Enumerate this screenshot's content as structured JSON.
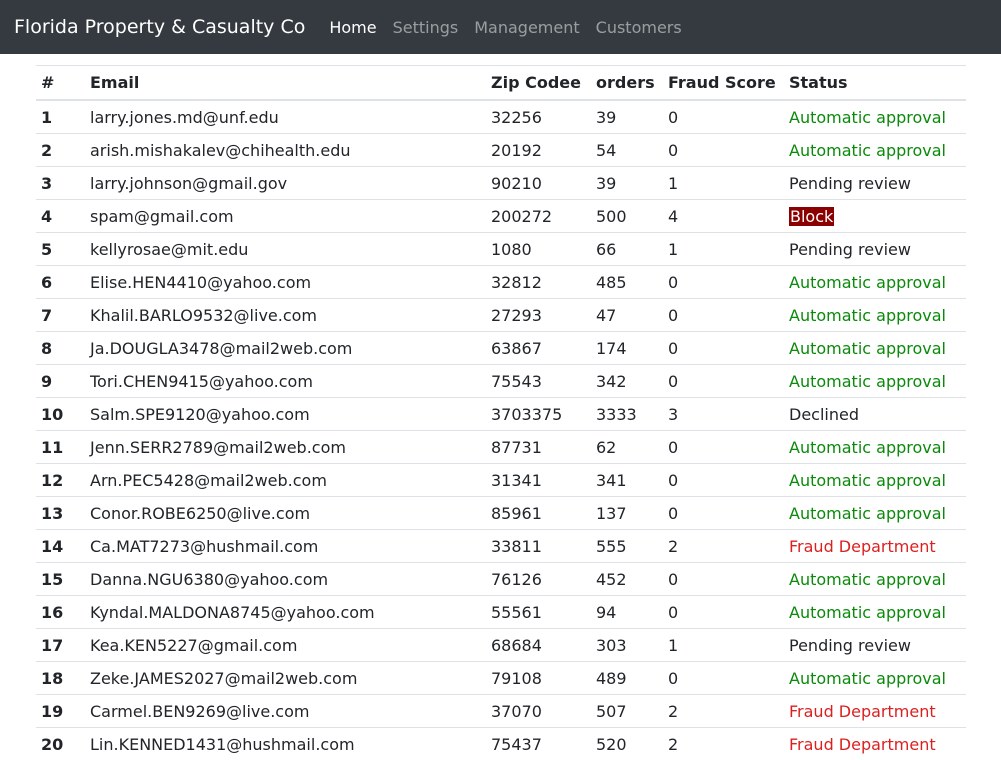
{
  "navbar": {
    "brand": "Florida Property & Casualty Co",
    "links": [
      {
        "label": "Home",
        "active": true
      },
      {
        "label": "Settings",
        "active": false
      },
      {
        "label": "Management",
        "active": false
      },
      {
        "label": "Customers",
        "active": false
      }
    ]
  },
  "table": {
    "headers": {
      "num": "#",
      "email": "Email",
      "zip": "Zip Codee",
      "orders": "orders",
      "fraud": "Fraud Score",
      "status": "Status"
    },
    "rows": [
      {
        "num": "1",
        "email": "larry.jones.md@unf.edu",
        "zip": "32256",
        "orders": "39",
        "fraud": "0",
        "status": "Automatic approval",
        "kind": "approval"
      },
      {
        "num": "2",
        "email": "arish.mishakalev@chihealth.edu",
        "zip": "20192",
        "orders": "54",
        "fraud": "0",
        "status": "Automatic approval",
        "kind": "approval"
      },
      {
        "num": "3",
        "email": "larry.johnson@gmail.gov",
        "zip": "90210",
        "orders": "39",
        "fraud": "1",
        "status": "Pending review",
        "kind": "pending"
      },
      {
        "num": "4",
        "email": "spam@gmail.com",
        "zip": "200272",
        "orders": "500",
        "fraud": "4",
        "status": "Block",
        "kind": "block"
      },
      {
        "num": "5",
        "email": "kellyrosae@mit.edu",
        "zip": "1080",
        "orders": "66",
        "fraud": "1",
        "status": "Pending review",
        "kind": "pending"
      },
      {
        "num": "6",
        "email": "Elise.HEN4410@yahoo.com",
        "zip": "32812",
        "orders": "485",
        "fraud": "0",
        "status": "Automatic approval",
        "kind": "approval"
      },
      {
        "num": "7",
        "email": "Khalil.BARLO9532@live.com",
        "zip": "27293",
        "orders": "47",
        "fraud": "0",
        "status": "Automatic approval",
        "kind": "approval"
      },
      {
        "num": "8",
        "email": "Ja.DOUGLA3478@mail2web.com",
        "zip": "63867",
        "orders": "174",
        "fraud": "0",
        "status": "Automatic approval",
        "kind": "approval"
      },
      {
        "num": "9",
        "email": "Tori.CHEN9415@yahoo.com",
        "zip": "75543",
        "orders": "342",
        "fraud": "0",
        "status": "Automatic approval",
        "kind": "approval"
      },
      {
        "num": "10",
        "email": "Salm.SPE9120@yahoo.com",
        "zip": "3703375",
        "orders": "3333",
        "fraud": "3",
        "status": "Declined",
        "kind": "declined"
      },
      {
        "num": "11",
        "email": "Jenn.SERR2789@mail2web.com",
        "zip": "87731",
        "orders": "62",
        "fraud": "0",
        "status": "Automatic approval",
        "kind": "approval"
      },
      {
        "num": "12",
        "email": "Arn.PEC5428@mail2web.com",
        "zip": "31341",
        "orders": "341",
        "fraud": "0",
        "status": "Automatic approval",
        "kind": "approval"
      },
      {
        "num": "13",
        "email": "Conor.ROBE6250@live.com",
        "zip": "85961",
        "orders": "137",
        "fraud": "0",
        "status": "Automatic approval",
        "kind": "approval"
      },
      {
        "num": "14",
        "email": "Ca.MAT7273@hushmail.com",
        "zip": "33811",
        "orders": "555",
        "fraud": "2",
        "status": "Fraud Department",
        "kind": "fraud"
      },
      {
        "num": "15",
        "email": "Danna.NGU6380@yahoo.com",
        "zip": "76126",
        "orders": "452",
        "fraud": "0",
        "status": "Automatic approval",
        "kind": "approval"
      },
      {
        "num": "16",
        "email": "Kyndal.MALDONA8745@yahoo.com",
        "zip": "55561",
        "orders": "94",
        "fraud": "0",
        "status": "Automatic approval",
        "kind": "approval"
      },
      {
        "num": "17",
        "email": "Kea.KEN5227@gmail.com",
        "zip": "68684",
        "orders": "303",
        "fraud": "1",
        "status": "Pending review",
        "kind": "pending"
      },
      {
        "num": "18",
        "email": "Zeke.JAMES2027@mail2web.com",
        "zip": "79108",
        "orders": "489",
        "fraud": "0",
        "status": "Automatic approval",
        "kind": "approval"
      },
      {
        "num": "19",
        "email": "Carmel.BEN9269@live.com",
        "zip": "37070",
        "orders": "507",
        "fraud": "2",
        "status": "Fraud Department",
        "kind": "fraud"
      },
      {
        "num": "20",
        "email": "Lin.KENNED1431@hushmail.com",
        "zip": "75437",
        "orders": "520",
        "fraud": "2",
        "status": "Fraud Department",
        "kind": "fraud"
      }
    ]
  },
  "colors": {
    "navbar_bg": "#343a40",
    "approval": "#0a8a0a",
    "fraud": "#dc1f1f",
    "block_bg": "#8b0000"
  }
}
